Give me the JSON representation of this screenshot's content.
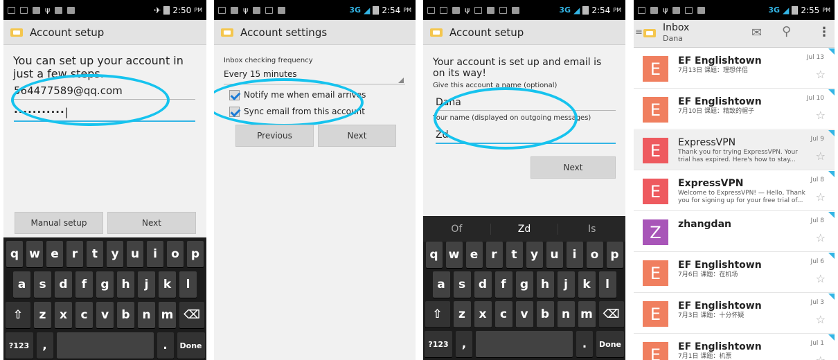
{
  "colors": {
    "accent": "#33b5e5",
    "annotation": "#16c3ee",
    "avatar_orange": "#f07f5f",
    "avatar_red": "#ee5a5f",
    "avatar_purple": "#a855b8"
  },
  "s1": {
    "status_time": "2:50",
    "status_ampm": "PM",
    "title": "Account setup",
    "intro": "You can set up your account in just a few steps.",
    "email_value": "564477589@qq.com",
    "password_value": "···········",
    "manual_setup": "Manual setup",
    "next": "Next"
  },
  "s2": {
    "status_net": "3G",
    "status_time": "2:54",
    "status_ampm": "PM",
    "title": "Account settings",
    "freq_label": "Inbox checking frequency",
    "freq_value": "Every 15 minutes",
    "notify": "Notify me when email arrives",
    "sync": "Sync email from this account",
    "previous": "Previous",
    "next": "Next"
  },
  "s3": {
    "status_net": "3G",
    "status_time": "2:54",
    "status_ampm": "PM",
    "title": "Account setup",
    "msg": "Your account is set up and email is on its way!",
    "name_label": "Give this account a name (optional)",
    "name_value": "Dana",
    "your_name_label": "Your name (displayed on outgoing messages)",
    "your_name_value": "Zd",
    "next": "Next",
    "suggestions": [
      "Of",
      "Zd",
      "Is"
    ]
  },
  "keyboard": {
    "row1": [
      "q",
      "w",
      "e",
      "r",
      "t",
      "y",
      "u",
      "i",
      "o",
      "p"
    ],
    "row2": [
      "a",
      "s",
      "d",
      "f",
      "g",
      "h",
      "j",
      "k",
      "l"
    ],
    "row3": [
      "z",
      "x",
      "c",
      "v",
      "b",
      "n",
      "m"
    ],
    "sym": "?123",
    "comma": ",",
    "period": ".",
    "done": "Done",
    "shift_icon": "shift-icon",
    "backspace_icon": "backspace-icon"
  },
  "s4": {
    "status_net": "3G",
    "status_time": "2:55",
    "status_ampm": "PM",
    "title": "Inbox",
    "account": "Dana",
    "icons": [
      "compose-icon",
      "search-icon",
      "overflow-menu-icon"
    ],
    "mails": [
      {
        "from": "EF Englishtown",
        "subject": "7月13日 课题：理想伴侣",
        "date": "Jul 13",
        "avatar": "E",
        "color": "#f07f5f",
        "read": false
      },
      {
        "from": "EF Englishtown",
        "subject": "7月10日 课题：精致的帽子",
        "date": "Jul 10",
        "avatar": "E",
        "color": "#f07f5f",
        "read": false
      },
      {
        "from": "ExpressVPN",
        "subject": "Thank you for trying ExpressVPN. Your trial has expired. Here's how to stay...",
        "date": "Jul 9",
        "avatar": "E",
        "color": "#ee5a5f",
        "read": true
      },
      {
        "from": "ExpressVPN",
        "subject": "Welcome to ExpressVPN! — Hello, Thank you for signing up for your free trial of...",
        "date": "Jul 8",
        "avatar": "E",
        "color": "#ee5a5f",
        "read": false
      },
      {
        "from": "zhangdan",
        "subject": "",
        "date": "Jul 8",
        "avatar": "Z",
        "color": "#a855b8",
        "read": false
      },
      {
        "from": "EF Englishtown",
        "subject": "7月6日 课题：在机场",
        "date": "Jul 6",
        "avatar": "E",
        "color": "#f07f5f",
        "read": false
      },
      {
        "from": "EF Englishtown",
        "subject": "7月3日 课题：十分怀疑",
        "date": "Jul 3",
        "avatar": "E",
        "color": "#f07f5f",
        "read": false
      },
      {
        "from": "EF Englishtown",
        "subject": "7月1日 课题：机票",
        "date": "Jul 1",
        "avatar": "E",
        "color": "#f07f5f",
        "read": false
      }
    ]
  }
}
